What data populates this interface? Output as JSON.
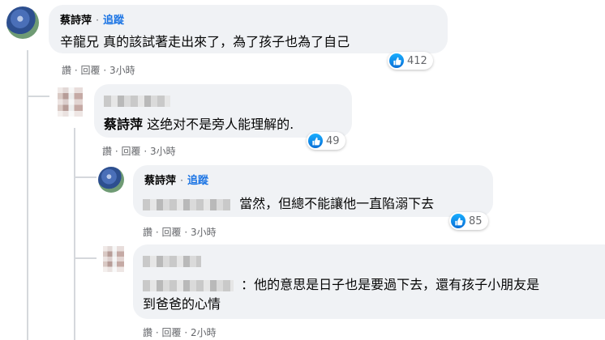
{
  "comments": [
    {
      "author": "蔡詩萍",
      "follow_label": "追蹤",
      "text": "辛龍兄 真的該試著走出來了，為了孩子也為了自己",
      "actions": {
        "like": "讚",
        "reply": "回覆",
        "time": "3小時"
      },
      "reactions": "412"
    },
    {
      "mention": "蔡詩萍",
      "text": "这绝对不是旁人能理解的.",
      "actions": {
        "like": "讚",
        "reply": "回覆",
        "time": "3小時"
      },
      "reactions": "49"
    },
    {
      "author": "蔡詩萍",
      "follow_label": "追蹤",
      "text": "當然，但總不能讓他一直陷溺下去",
      "actions": {
        "like": "讚",
        "reply": "回覆",
        "time": "3小時"
      },
      "reactions": "85"
    },
    {
      "text_line1": "：他的意思是日子也是要過下去，還有孩子小朋友是",
      "text_line2": "到爸爸的心情",
      "actions": {
        "like": "讚",
        "reply": "回覆",
        "time": "2小時"
      }
    }
  ],
  "separator": "·",
  "icons": {
    "like": "thumbs-up-icon"
  },
  "colors": {
    "link": "#1b74e4",
    "bubble": "#f0f2f5",
    "like": "#0a6ed6"
  }
}
